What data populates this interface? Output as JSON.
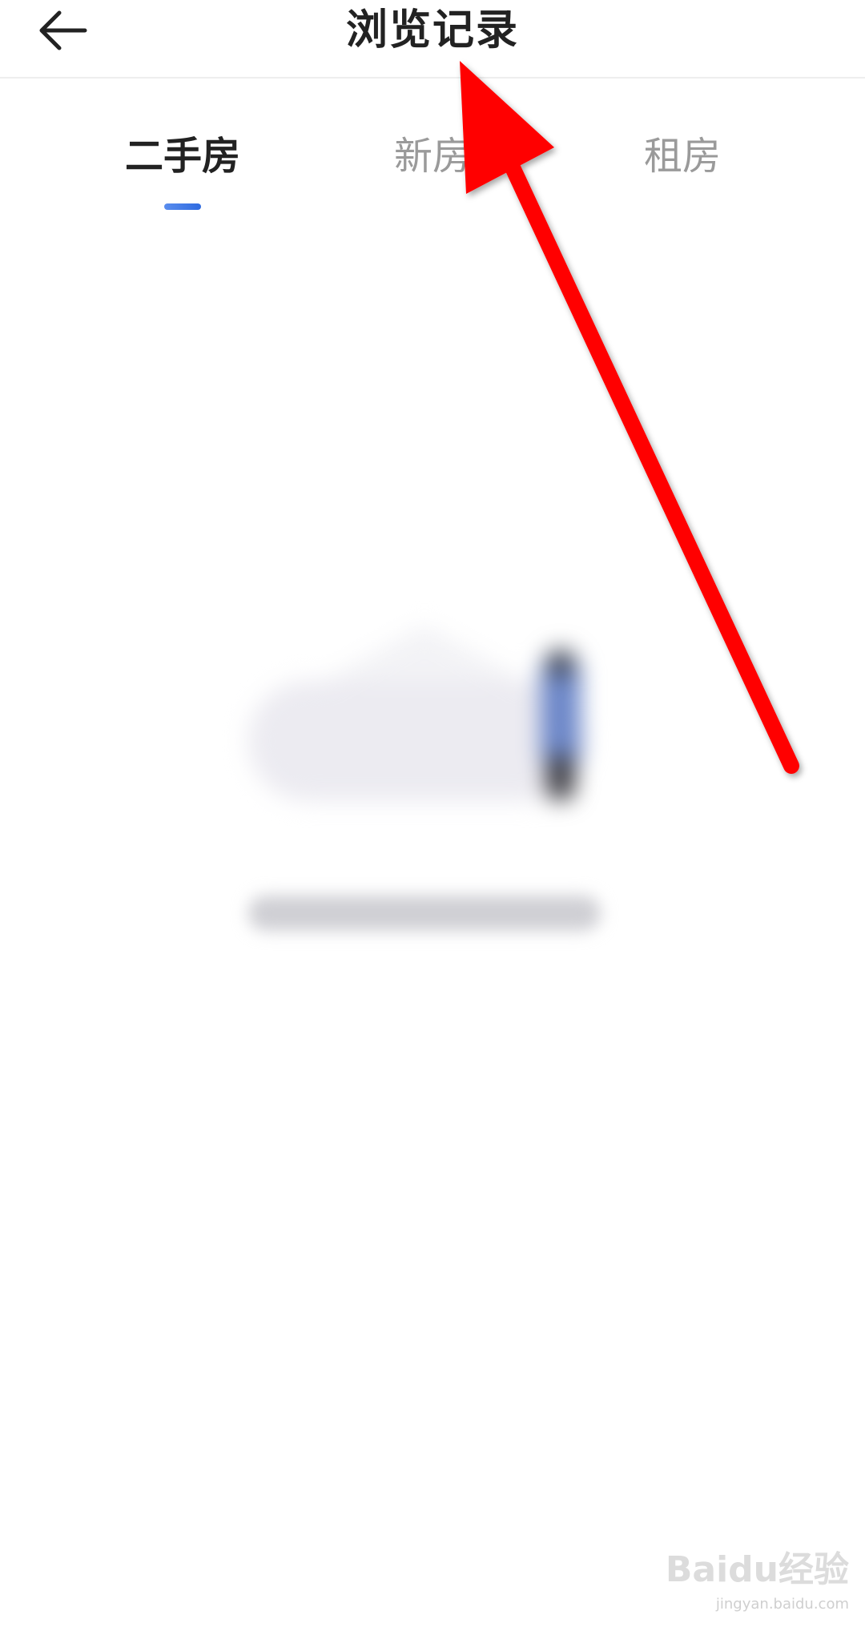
{
  "header": {
    "title": "浏览记录",
    "back_icon": "arrow-left-icon"
  },
  "tabs": [
    {
      "label": "二手房",
      "active": true
    },
    {
      "label": "新房",
      "active": false
    },
    {
      "label": "租房",
      "active": false
    }
  ],
  "colors": {
    "active_indicator": "#2f6be0",
    "annotation_arrow": "#ff0000",
    "title_text": "#222222",
    "inactive_tab_text": "#9a9a9a"
  },
  "watermark": {
    "brand": "Baidu经验",
    "url": "jingyan.baidu.com"
  }
}
